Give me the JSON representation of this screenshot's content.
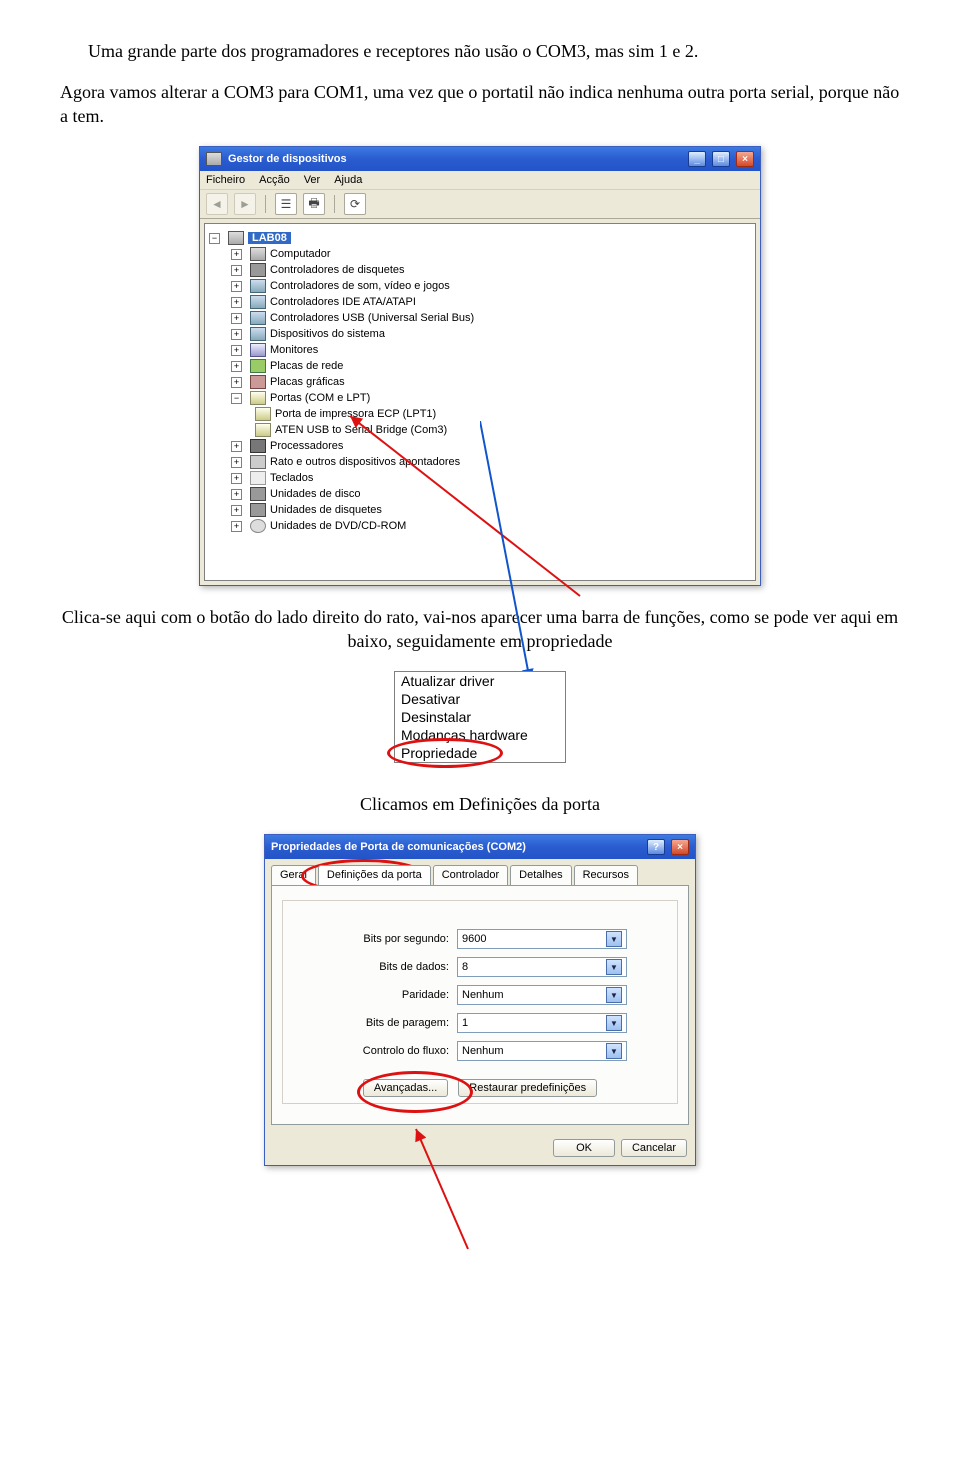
{
  "paragraphs": {
    "p1": "Uma grande parte dos programadores e receptores não usão o COM3, mas sim 1 e 2.",
    "p2": "Agora vamos alterar a COM3 para COM1, uma vez que o portatil não indica nenhuma outra porta serial, porque não a tem.",
    "p3": "Clica-se aqui com o botão do lado direito do rato, vai-nos aparecer uma barra de funções, como se pode ver aqui em baixo, seguidamente em propriedade",
    "p4": "Clicamos em Definições da porta"
  },
  "devmgr": {
    "title": "Gestor de dispositivos",
    "menu": {
      "m1": "Ficheiro",
      "m2": "Acção",
      "m3": "Ver",
      "m4": "Ajuda"
    },
    "root": "LAB08",
    "items": [
      "Computador",
      "Controladores de disquetes",
      "Controladores de som, vídeo e jogos",
      "Controladores IDE ATA/ATAPI",
      "Controladores USB (Universal Serial Bus)",
      "Dispositivos do sistema",
      "Monitores",
      "Placas de rede",
      "Placas gráficas",
      "Portas (COM e LPT)",
      "Processadores",
      "Rato e outros dispositivos apontadores",
      "Teclados",
      "Unidades de disco",
      "Unidades de disquetes",
      "Unidades de DVD/CD-ROM"
    ],
    "port_children": [
      "Porta de impressora ECP (LPT1)",
      "ATEN USB to Serial Bridge (Com3)"
    ]
  },
  "context_menu": {
    "i1": "Atualizar driver",
    "i2": "Desativar",
    "i3": "Desinstalar",
    "i4": "Modanças hardware",
    "i5": "Propriedade"
  },
  "props": {
    "title": "Propriedades de Porta de comunicações (COM2)",
    "tabs": {
      "t1": "Geral",
      "t2": "Definições da porta",
      "t3": "Controlador",
      "t4": "Detalhes",
      "t5": "Recursos"
    },
    "fields": {
      "bps_label": "Bits por segundo:",
      "bps_value": "9600",
      "databits_label": "Bits de dados:",
      "databits_value": "8",
      "parity_label": "Paridade:",
      "parity_value": "Nenhum",
      "stopbits_label": "Bits de paragem:",
      "stopbits_value": "1",
      "flow_label": "Controlo do fluxo:",
      "flow_value": "Nenhum"
    },
    "buttons": {
      "advanced": "Avançadas...",
      "restore": "Restaurar predefinições",
      "ok": "OK",
      "cancel": "Cancelar"
    }
  }
}
